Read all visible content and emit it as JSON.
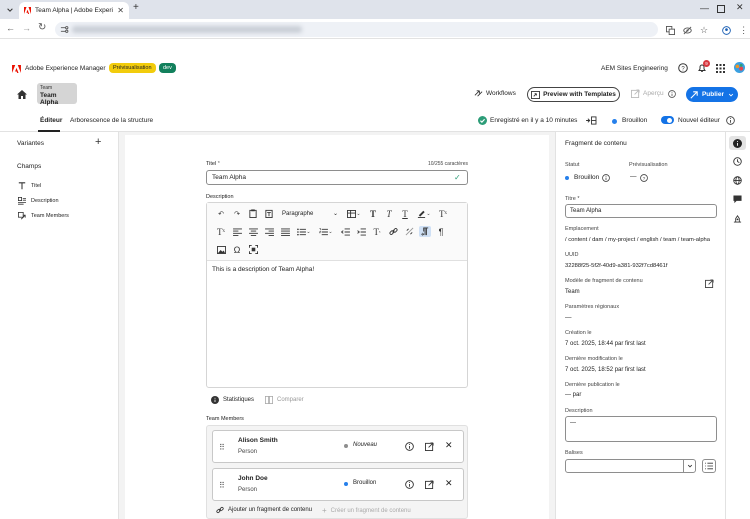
{
  "browser": {
    "tab_title": "Team Alpha | Adobe Experience",
    "new_tab": "+"
  },
  "aem": {
    "product": "Adobe Experience Manager",
    "badge_preview": "Prévisualisation",
    "badge_env": "dev",
    "org": "AEM Sites Engineering",
    "notification_count": "9"
  },
  "titlebar": {
    "crumb_small": "Team",
    "crumb_title": "Team Alpha",
    "workflows": "Workflows",
    "preview_templates": "Preview with Templates",
    "apercu": "Aperçu",
    "publish": "Publier"
  },
  "tabs": {
    "editor": "Éditeur",
    "structure": "Arborescence de la structure",
    "saved": "Enregistré en il y a 10 minutes",
    "draft": "Brouillon",
    "new_editor": "Nouvel éditeur"
  },
  "left": {
    "variants": "Variantes",
    "fields": "Champs",
    "items": [
      "Titel",
      "Description",
      "Team Members"
    ]
  },
  "form": {
    "title_label": "Titel",
    "required_mark": "*",
    "char_count": "10/255 caractères",
    "title_value": "Team Alpha",
    "desc_label": "Description",
    "paragraph": "Paragraphe",
    "desc_text": "This is a description of Team Alpha!",
    "stats": "Statistiques",
    "compare": "Comparer",
    "members_label": "Team Members",
    "members": [
      {
        "name": "Alison Smith",
        "type": "Person",
        "status": "Nouveau",
        "status_color": "#8e8e8e"
      },
      {
        "name": "John Doe",
        "type": "Person",
        "status": "Brouillon",
        "status_color": "#2680eb"
      }
    ],
    "add_fragment": "Ajouter un fragment de contenu",
    "create_fragment": "Créer un fragment de contenu"
  },
  "right": {
    "header": "Fragment de contenu",
    "status_label": "Statut",
    "status_value": "Brouillon",
    "preview_label": "Prévisualisation",
    "preview_value": "—",
    "title_label": "Titre",
    "title_value": "Team Alpha",
    "location_label": "Emplacement",
    "location_value": "/ content / dam / my-project / english / team / team-alpha",
    "uuid_label": "UUID",
    "uuid_value": "32288f25-5f2f-40d9-a381-932f7cd8461f",
    "model_label": "Modèle de fragment de contenu",
    "model_value": "Team",
    "regional_label": "Paramètres régionaux",
    "regional_value": "—",
    "created_label": "Création le",
    "created_value": "7 oct. 2025, 18:44 par first last",
    "modified_label": "Dernière modification le",
    "modified_value": "7 oct. 2025, 18:52 par first last",
    "published_label": "Dernière publication le",
    "published_value": "— par",
    "description_label": "Description",
    "description_value": "—",
    "tags_label": "Balises"
  },
  "colors": {
    "accent": "#1473e6",
    "preview_badge": "#f2cc0c",
    "env_badge": "#12805c",
    "saved_green": "#2d9d78",
    "adobe_red": "#eb1000"
  }
}
